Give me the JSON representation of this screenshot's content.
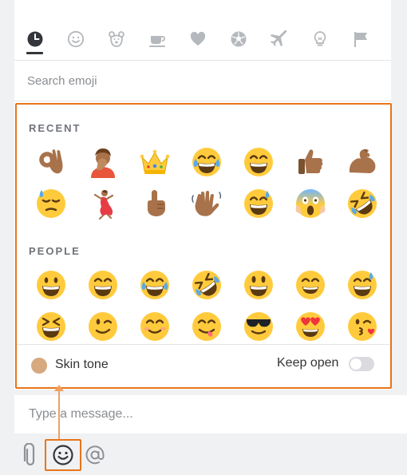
{
  "tabs": [
    {
      "id": "recent",
      "icon": "clock-icon",
      "active": true
    },
    {
      "id": "people",
      "icon": "smiley-icon",
      "active": false
    },
    {
      "id": "nature",
      "icon": "bear-icon",
      "active": false
    },
    {
      "id": "food",
      "icon": "coffee-cup-icon",
      "active": false
    },
    {
      "id": "activities",
      "icon": "heart-icon",
      "active": false
    },
    {
      "id": "sports",
      "icon": "soccer-ball-icon",
      "active": false
    },
    {
      "id": "travel",
      "icon": "airplane-icon",
      "active": false
    },
    {
      "id": "objects",
      "icon": "lightbulb-icon",
      "active": false
    },
    {
      "id": "flags",
      "icon": "flag-icon",
      "active": false
    }
  ],
  "search": {
    "placeholder": "Search emoji"
  },
  "sections": [
    {
      "label": "RECENT",
      "emojis": [
        "ok-hand-medium-skin",
        "person-facepalming-medium-skin",
        "crown",
        "face-with-tears-of-joy",
        "beaming-face",
        "thumbs-up-medium-skin",
        "flexed-biceps-medium-skin",
        "downcast-face-with-sweat",
        "woman-dancing-medium-skin",
        "index-pointing-up-medium-skin",
        "waving-hand-medium-skin",
        "grinning-face-with-sweat",
        "face-screaming-in-fear",
        "rolling-on-the-floor-laughing"
      ]
    },
    {
      "label": "PEOPLE",
      "emojis": [
        "grinning-face",
        "beaming-face",
        "face-with-tears-of-joy",
        "rolling-on-the-floor-laughing",
        "grinning-face-big-eyes",
        "grinning-face-smiling-eyes",
        "grinning-face-with-sweat",
        "squinting-face",
        "winking-face",
        "smiling-face",
        "face-savoring-food",
        "smiling-face-with-sunglasses",
        "smiling-face-with-heart-eyes",
        "face-blowing-kiss"
      ]
    }
  ],
  "footer": {
    "skin_tone_label": "Skin tone",
    "skin_tone_color": "#d7a97f",
    "keep_open_label": "Keep open",
    "keep_open": false
  },
  "composer": {
    "placeholder": "Type a message..."
  },
  "toolbar": {
    "attach_icon": "paperclip-icon",
    "emoji_icon": "smiley-icon",
    "mention_icon": "at-sign-icon"
  },
  "colors": {
    "accent": "#e8751a",
    "emoji_yellow": "#ffcb3d",
    "skin_medium": "#a8724b"
  }
}
